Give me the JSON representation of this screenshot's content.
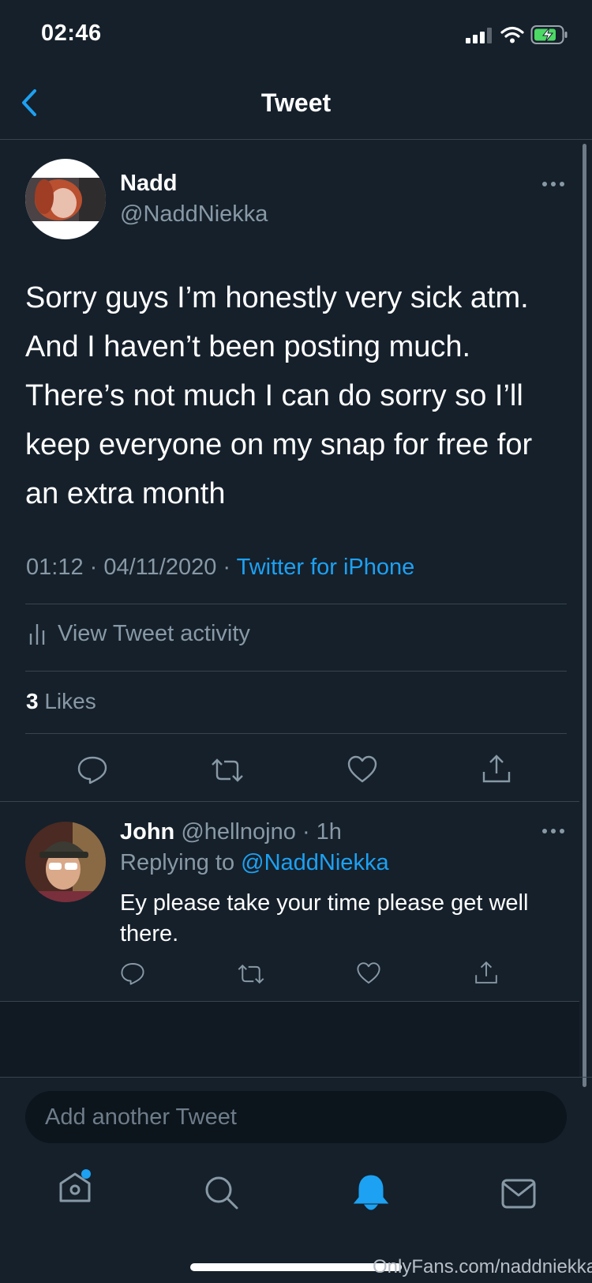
{
  "status_bar": {
    "time": "02:46"
  },
  "nav": {
    "title": "Tweet"
  },
  "tweet": {
    "author_name": "Nadd",
    "author_handle": "@NaddNiekka",
    "text": "Sorry guys I’m honestly very sick atm. And I haven’t been posting much. There’s not much I can do sorry so I’ll keep everyone on my snap for free for an extra month",
    "time": "01:12",
    "date": "04/11/2020",
    "source": "Twitter for iPhone",
    "activity_label": "View Tweet activity",
    "likes_count": "3",
    "likes_label": "Likes"
  },
  "reply": {
    "author_name": "John",
    "author_handle": "@hellnojno",
    "age": "1h",
    "replying_label": "Replying to",
    "replying_handle": "@NaddNiekka",
    "text": "Ey please take your time please get well there."
  },
  "compose": {
    "placeholder": "Add another Tweet"
  },
  "tabs": [
    "home",
    "search",
    "notifications",
    "messages"
  ],
  "watermark": "OnlyFans.com/naddniekka",
  "colors": {
    "background": "#15202b",
    "accent": "#1da1f2",
    "muted": "#8899a6",
    "divider": "#38444d"
  }
}
